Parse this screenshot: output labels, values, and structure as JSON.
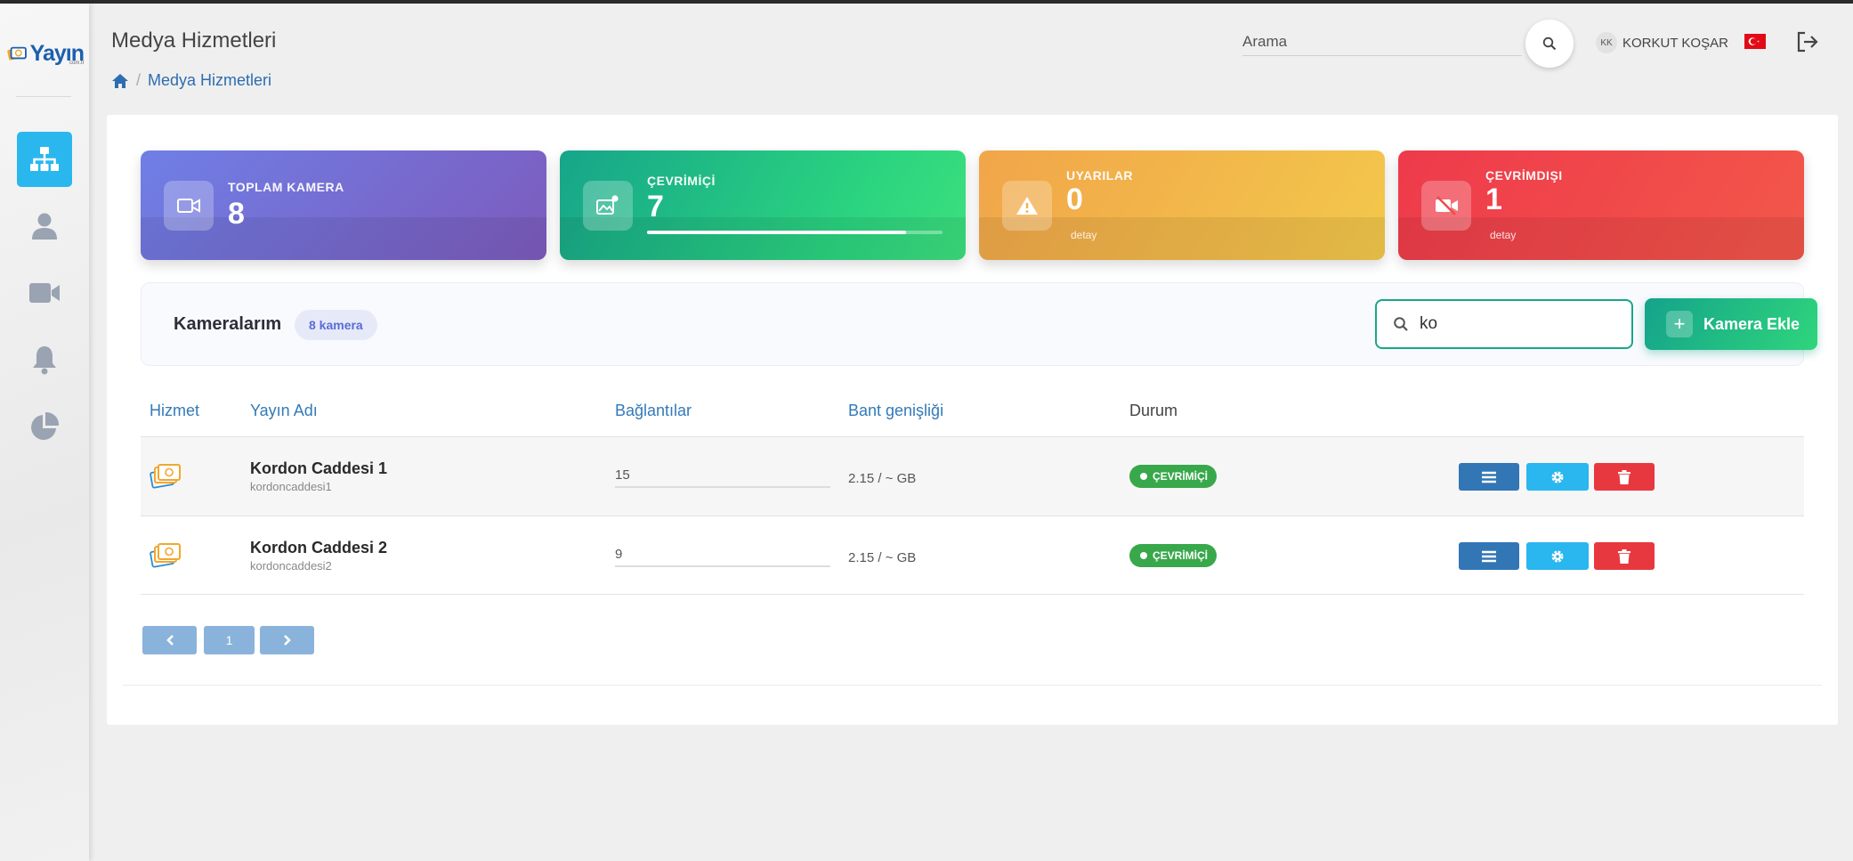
{
  "app": {
    "logo_text": "Yayın",
    "logo_sub": "com.tr",
    "page_title": "Medya Hizmetleri",
    "breadcrumb": [
      "Medya Hizmetleri"
    ]
  },
  "header": {
    "search_placeholder": "Arama",
    "user_initials": "KK",
    "user_name": "KORKUT KOŞAR",
    "language_flag": "turkey-flag-icon"
  },
  "sidebar": {
    "items": [
      {
        "icon": "sitemap-icon",
        "active": true
      },
      {
        "icon": "user-icon",
        "active": false
      },
      {
        "icon": "video-camera-icon",
        "active": false
      },
      {
        "icon": "bell-icon",
        "active": false
      },
      {
        "icon": "pie-chart-icon",
        "active": false
      }
    ]
  },
  "stats": {
    "total": {
      "label": "TOPLAM KAMERA",
      "value": "8"
    },
    "online": {
      "label": "ÇEVRİMİÇİ",
      "value": "7",
      "progress": 0.875
    },
    "warnings": {
      "label": "UYARILAR",
      "value": "0",
      "sub": "detay"
    },
    "offline": {
      "label": "ÇEVRİMDIŞI",
      "value": "1",
      "sub": "detay"
    }
  },
  "cameras": {
    "title": "Kameralarım",
    "count_badge": "8 kamera",
    "filter_value": "ko",
    "add_button": "Kamera Ekle"
  },
  "table": {
    "columns": [
      "Hizmet",
      "Yayın Adı",
      "Bağlantılar",
      "Bant genişliği",
      "Durum"
    ],
    "rows": [
      {
        "name": "Kordon Caddesi 1",
        "slug": "kordoncaddesi1",
        "connections": "15",
        "bandwidth": "2.15 / ~ GB",
        "status": "ÇEVRİMİÇİ"
      },
      {
        "name": "Kordon Caddesi 2",
        "slug": "kordoncaddesi2",
        "connections": "9",
        "bandwidth": "2.15 / ~ GB",
        "status": "ÇEVRİMİÇİ"
      }
    ]
  },
  "pagination": {
    "current": "1"
  },
  "colors": {
    "accent": "#2ab7ee",
    "online_green": "#38a84b",
    "danger": "#e8383f",
    "primary": "#3276b5"
  }
}
